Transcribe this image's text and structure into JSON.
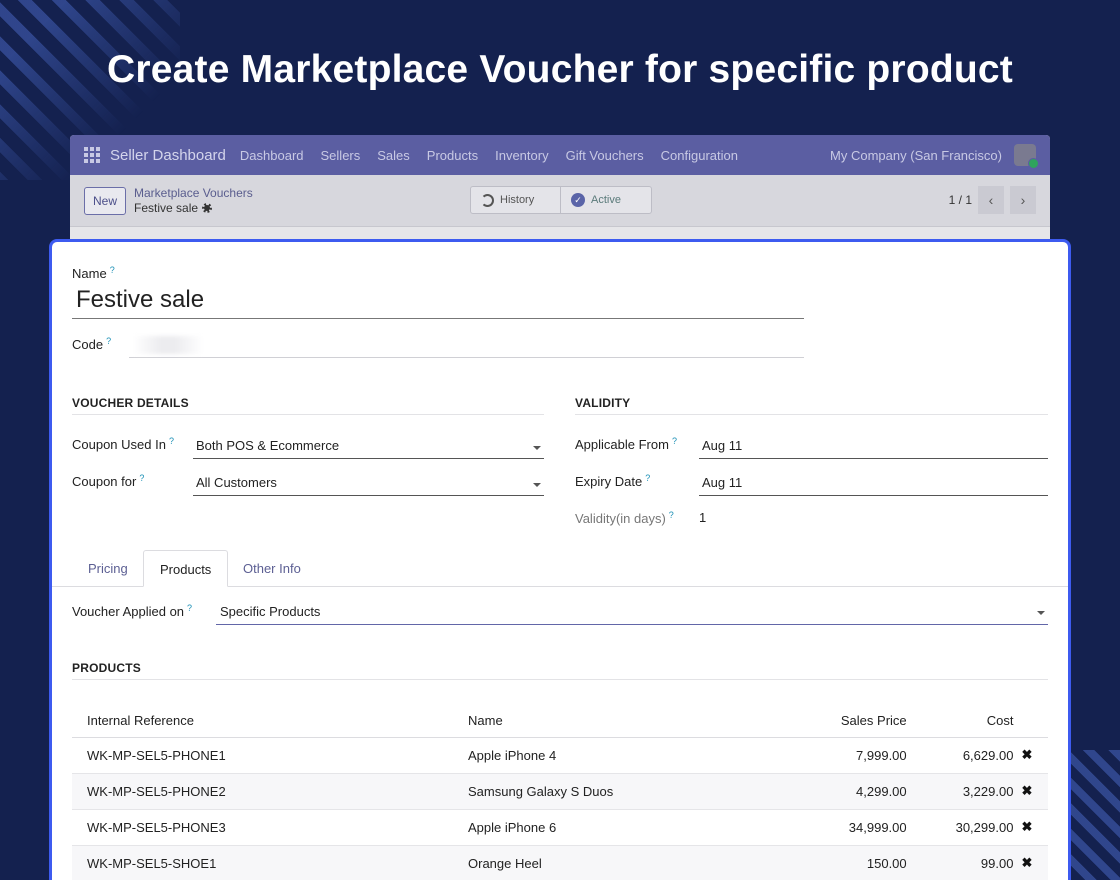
{
  "headline": "Create Marketplace Voucher for specific product",
  "topnav": {
    "brand": "Seller Dashboard",
    "menus": [
      "Dashboard",
      "Sellers",
      "Sales",
      "Products",
      "Inventory",
      "Gift Vouchers",
      "Configuration"
    ],
    "company": "My Company (San Francisco)"
  },
  "control": {
    "new_label": "New",
    "breadcrumb_parent": "Marketplace Vouchers",
    "breadcrumb_current": "Festive sale",
    "history_label": "History",
    "active_label": "Active",
    "pager": "1 / 1"
  },
  "form": {
    "name_label": "Name",
    "name_value": "Festive sale",
    "code_label": "Code",
    "help_mark": "?",
    "voucher_details": {
      "title": "VOUCHER DETAILS",
      "coupon_used_in_label": "Coupon Used In",
      "coupon_used_in_value": "Both POS & Ecommerce",
      "coupon_for_label": "Coupon for",
      "coupon_for_value": "All Customers"
    },
    "validity": {
      "title": "VALIDITY",
      "applicable_from_label": "Applicable From",
      "applicable_from_value": "Aug 11",
      "expiry_date_label": "Expiry Date",
      "expiry_date_value": "Aug 11",
      "validity_days_label": "Validity(in days)",
      "validity_days_value": "1"
    },
    "tabs": [
      "Pricing",
      "Products",
      "Other Info"
    ],
    "active_tab": "Products",
    "voucher_applied_on_label": "Voucher Applied on",
    "voucher_applied_on_value": "Specific Products",
    "products_title": "PRODUCTS",
    "columns": [
      "Internal Reference",
      "Name",
      "Sales Price",
      "Cost"
    ],
    "rows": [
      {
        "ref": "WK-MP-SEL5-PHONE1",
        "name": "Apple iPhone 4",
        "price": "7,999.00",
        "cost": "6,629.00"
      },
      {
        "ref": "WK-MP-SEL5-PHONE2",
        "name": "Samsung Galaxy S Duos",
        "price": "4,299.00",
        "cost": "3,229.00"
      },
      {
        "ref": "WK-MP-SEL5-PHONE3",
        "name": "Apple iPhone 6",
        "price": "34,999.00",
        "cost": "30,299.00"
      },
      {
        "ref": "WK-MP-SEL5-SHOE1",
        "name": "Orange Heel",
        "price": "150.00",
        "cost": "99.00"
      }
    ],
    "delete_glyph": "✖"
  }
}
